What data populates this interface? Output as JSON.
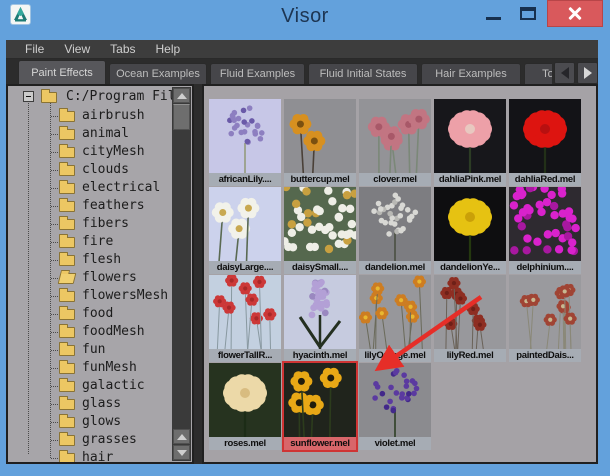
{
  "window": {
    "title": "Visor",
    "app_icon": "maya-logo"
  },
  "titlebar": {
    "controls": [
      "minimize",
      "maximize",
      "close"
    ]
  },
  "menubar": {
    "items": [
      "File",
      "View",
      "Tabs",
      "Help"
    ]
  },
  "tabs": {
    "items": [
      {
        "label": "Paint Effects",
        "active": true
      },
      {
        "label": "Ocean Examples",
        "active": false
      },
      {
        "label": "Fluid Examples",
        "active": false
      },
      {
        "label": "Fluid Initial States",
        "active": false
      },
      {
        "label": "Hair Examples",
        "active": false
      },
      {
        "label": "Toon",
        "active": false
      }
    ],
    "scroll_arrows": [
      "left",
      "right"
    ]
  },
  "tree": {
    "root": {
      "label": "C:/Program Files",
      "expanded": true
    },
    "items": [
      "airbrush",
      "animal",
      "cityMesh",
      "clouds",
      "electrical",
      "feathers",
      "fibers",
      "fire",
      "flesh",
      "flowers",
      "flowersMesh",
      "food",
      "foodMesh",
      "fun",
      "funMesh",
      "galactic",
      "glass",
      "glows",
      "grasses",
      "hair"
    ],
    "open_item": "flowers"
  },
  "thumbnails": {
    "selected": "sunflower.mel",
    "items": [
      {
        "label": "africanLily....",
        "bg": "#c7c7e7",
        "c1": "#8d7fc0",
        "c2": "#6a5aa8",
        "stem": "#9aa089",
        "style": "cluster",
        "n": 24
      },
      {
        "label": "buttercup.mel",
        "bg": "#8f8f93",
        "c1": "#d79020",
        "c2": "#7a5010",
        "stem": "#4a4038",
        "style": "few",
        "n": 2
      },
      {
        "label": "clover.mel",
        "bg": "#939397",
        "c1": "#c27582",
        "c2": "#a85868",
        "stem": "#7b8878",
        "style": "few",
        "n": 5
      },
      {
        "label": "dahliaPink.mel",
        "bg": "#17171b",
        "c1": "#eda0a8",
        "c2": "#e8c8c0",
        "stem": "#2c3c24",
        "style": "single"
      },
      {
        "label": "dahliaRed.mel",
        "bg": "#131317",
        "c1": "#dd1410",
        "c2": "#b81010",
        "stem": "#223018",
        "style": "single"
      },
      {
        "label": "daisyLarge....",
        "bg": "#ccd2ec",
        "c1": "#f2f2ea",
        "c2": "#c8a850",
        "stem": "#5a6a52",
        "style": "few",
        "n": 3
      },
      {
        "label": "daisySmall....",
        "bg": "#55684e",
        "c1": "#eeeee6",
        "c2": "#c8a040",
        "stem": "#3c5038",
        "style": "dense"
      },
      {
        "label": "dandelion.mel",
        "bg": "#7d7d81",
        "c1": "#d8d8d4",
        "c2": "#b8b8b4",
        "stem": "#505448",
        "style": "cluster",
        "n": 30
      },
      {
        "label": "dandelionYe...",
        "bg": "#0e0e10",
        "c1": "#e6c212",
        "c2": "#caa008",
        "stem": "#24380f",
        "style": "single"
      },
      {
        "label": "delphinium....",
        "bg": "#2e2a30",
        "c1": "#d922cc",
        "c2": "#a818a0",
        "stem": "#303828",
        "style": "dense"
      },
      {
        "label": "flowerTallR...",
        "bg": "#c3d0e0",
        "c1": "#cc3838",
        "c2": "#a82828",
        "stem": "#8898a0",
        "style": "spray",
        "n": 8
      },
      {
        "label": "hyacinth.mel",
        "bg": "#c6cbdf",
        "c1": "#b3a0d6",
        "c2": "#9a88c0",
        "stem": "#243020",
        "style": "spike"
      },
      {
        "label": "lilyOrange.mel",
        "bg": "#97979b",
        "c1": "#cd7d22",
        "c2": "#e8b830",
        "stem": "#6a6a5a",
        "style": "spray",
        "n": 8
      },
      {
        "label": "lilyRed.mel",
        "bg": "#98989c",
        "c1": "#8e2e22",
        "c2": "#6e2018",
        "stem": "#6a6258",
        "style": "spray",
        "n": 8
      },
      {
        "label": "paintedDais...",
        "bg": "#9a9a9e",
        "c1": "#a04434",
        "c2": "#c8b890",
        "stem": "#8a8878",
        "style": "spray",
        "n": 9
      },
      {
        "label": "roses.mel",
        "bg": "#26331f",
        "c1": "#ecd9a8",
        "c2": "#d8bc80",
        "stem": "#1c2c16",
        "style": "single"
      },
      {
        "label": "sunflower.mel",
        "bg": "#20241c",
        "c1": "#e8a816",
        "c2": "#201c0c",
        "stem": "#2c3c1c",
        "style": "few",
        "n": 4,
        "selected": true
      },
      {
        "label": "violet.mel",
        "bg": "#8b8b8f",
        "c1": "#5b3aa0",
        "c2": "#42288a",
        "stem": "#384830",
        "style": "cluster",
        "n": 26
      }
    ]
  },
  "annotation": {
    "type": "arrow",
    "color": "#e62e28",
    "points_to": "sunflower.mel"
  },
  "colors": {
    "titlebar": "#63a1dc",
    "close_button": "#d9595c",
    "menubar": "#3d3d3d",
    "tab_active": "#57575b",
    "tab_inactive": "#46464a",
    "panel_bg": "#a5a2a6",
    "selection": "#cf3434",
    "selected_label_bg": "#d8666a",
    "folder": "#ecc763"
  }
}
